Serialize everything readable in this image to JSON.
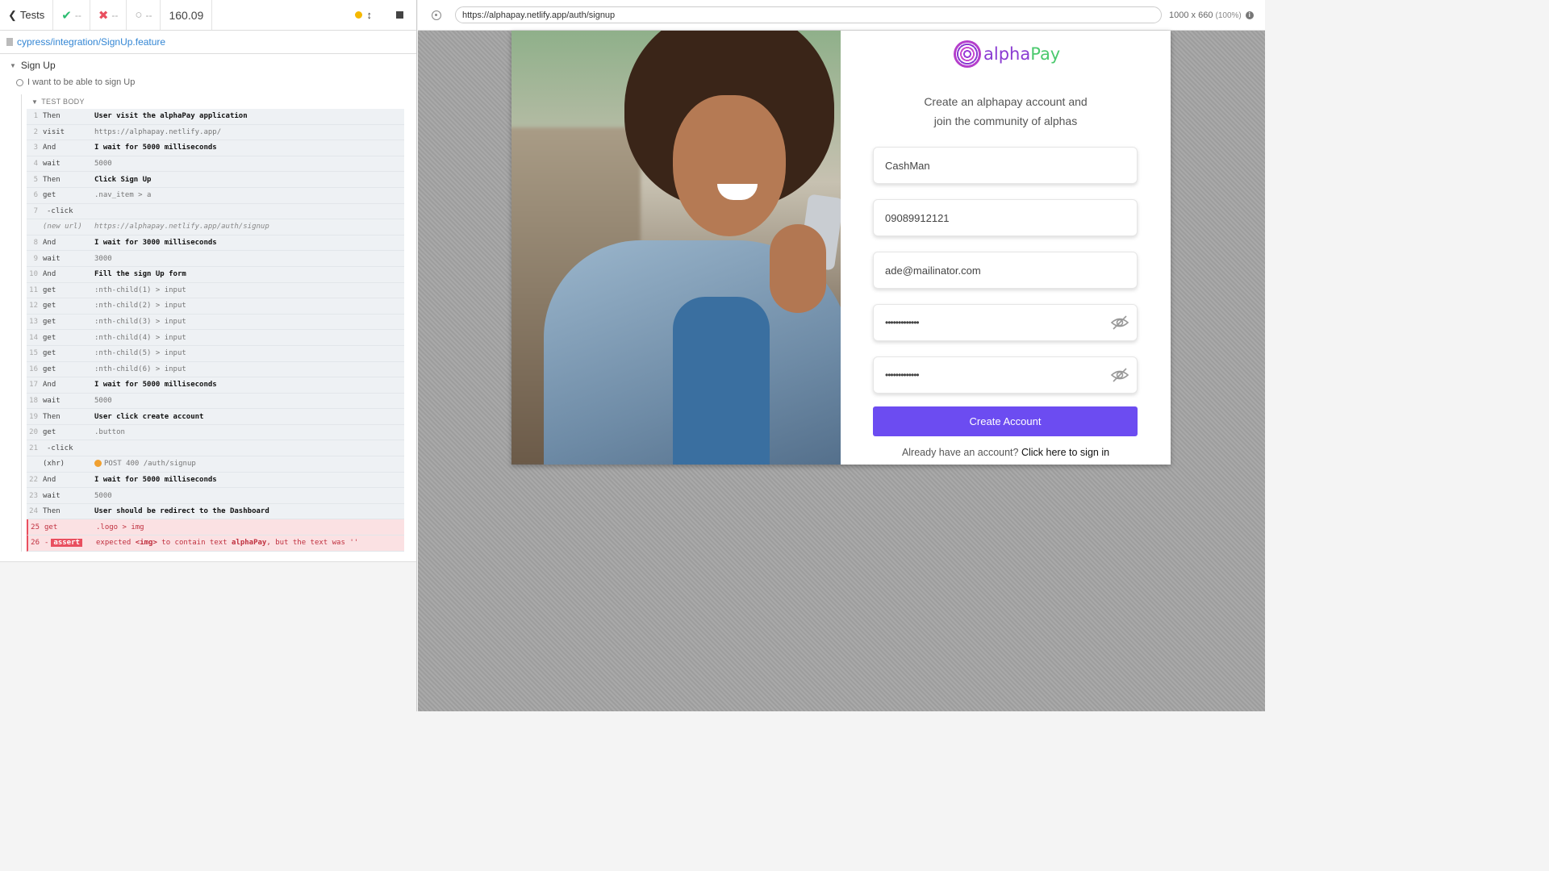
{
  "reporter": {
    "back_label": "Tests",
    "passed": "--",
    "failed": "--",
    "pending": "--",
    "duration": "160.09",
    "spec_path": "cypress/integration/SignUp.feature",
    "suite_title": "Sign Up",
    "test_title": "I want to be able to sign Up",
    "test_body_label": "TEST BODY",
    "commands": [
      {
        "num": "1",
        "name": "Then",
        "msg": "User visit the alphaPay application",
        "kind": "step"
      },
      {
        "num": "2",
        "name": "visit",
        "msg": "https://alphapay.netlify.app/",
        "kind": "cmd"
      },
      {
        "num": "3",
        "name": "And",
        "msg": "I wait for 5000 milliseconds",
        "kind": "step"
      },
      {
        "num": "4",
        "name": "wait",
        "msg": "5000",
        "kind": "cmd"
      },
      {
        "num": "5",
        "name": "Then",
        "msg": "Click Sign Up",
        "kind": "step"
      },
      {
        "num": "6",
        "name": "get",
        "msg": ".nav_item > a",
        "kind": "cmd"
      },
      {
        "num": "7",
        "name": "-click",
        "msg": "",
        "kind": "child"
      },
      {
        "num": "",
        "name": "(new url)",
        "msg": "https://alphapay.netlify.app/auth/signup",
        "kind": "event"
      },
      {
        "num": "8",
        "name": "And",
        "msg": "I wait for 3000 milliseconds",
        "kind": "step"
      },
      {
        "num": "9",
        "name": "wait",
        "msg": "3000",
        "kind": "cmd"
      },
      {
        "num": "10",
        "name": "And",
        "msg": "Fill the sign Up form",
        "kind": "step"
      },
      {
        "num": "11",
        "name": "get",
        "msg": ":nth-child(1) > input",
        "kind": "cmd"
      },
      {
        "num": "12",
        "name": "get",
        "msg": ":nth-child(2) > input",
        "kind": "cmd"
      },
      {
        "num": "13",
        "name": "get",
        "msg": ":nth-child(3) > input",
        "kind": "cmd"
      },
      {
        "num": "14",
        "name": "get",
        "msg": ":nth-child(4) > input",
        "kind": "cmd"
      },
      {
        "num": "15",
        "name": "get",
        "msg": ":nth-child(5) > input",
        "kind": "cmd"
      },
      {
        "num": "16",
        "name": "get",
        "msg": ":nth-child(6) > input",
        "kind": "cmd"
      },
      {
        "num": "17",
        "name": "And",
        "msg": "I wait for 5000 milliseconds",
        "kind": "step"
      },
      {
        "num": "18",
        "name": "wait",
        "msg": "5000",
        "kind": "cmd"
      },
      {
        "num": "19",
        "name": "Then",
        "msg": "User click create account",
        "kind": "step"
      },
      {
        "num": "20",
        "name": "get",
        "msg": ".button",
        "kind": "cmd"
      },
      {
        "num": "21",
        "name": "-click",
        "msg": "",
        "kind": "child"
      },
      {
        "num": "",
        "name": "(xhr)",
        "msg": "POST 400 /auth/signup",
        "kind": "xhr"
      },
      {
        "num": "22",
        "name": "And",
        "msg": "I wait for 5000 milliseconds",
        "kind": "step"
      },
      {
        "num": "23",
        "name": "wait",
        "msg": "5000",
        "kind": "cmd"
      },
      {
        "num": "24",
        "name": "Then",
        "msg": "User should be redirect to the Dashboard",
        "kind": "step"
      },
      {
        "num": "25",
        "name": "get",
        "msg": ".logo > img",
        "kind": "err"
      }
    ],
    "assert_row": {
      "num": "26",
      "prefix": "-",
      "badge": "assert",
      "msg_1": "expected",
      "msg_el": "<img>",
      "msg_2": "to contain text",
      "msg_text": "alphaPay",
      "msg_3": ", but the text was",
      "msg_4": "''"
    }
  },
  "aut": {
    "url": "https://alphapay.netlify.app/auth/signup",
    "viewport": "1000 x 660",
    "zoom": "(100%)",
    "logo_part_a": "alpha",
    "logo_part_b": "Pay",
    "tagline_1": "Create an alphapay account and",
    "tagline_2": "join the community of alphas",
    "fields": [
      {
        "value": "CashMan"
      },
      {
        "value": "09089912121"
      },
      {
        "value": "ade@mailinator.com"
      },
      {
        "value": "•••••••••••••"
      },
      {
        "value": "•••••••••••••"
      }
    ],
    "create_button": "Create Account",
    "signin_prompt": "Already have an account?",
    "signin_link": "Click here to sign in"
  },
  "colors": {
    "accent_button": "#6c4cf1",
    "logo_purple": "#8a3bd2",
    "logo_green": "#4bc96e",
    "fail_red": "#e94f5f",
    "pass_green": "#2cbd71"
  },
  "icons": [
    "chevron-left-icon",
    "check-icon",
    "x-icon",
    "circle-icon",
    "running-dot-icon",
    "resize-icon",
    "stop-icon",
    "file-icon",
    "caret-down-icon",
    "spinner-icon",
    "crosshair-icon",
    "info-icon",
    "eye-slash-icon"
  ]
}
